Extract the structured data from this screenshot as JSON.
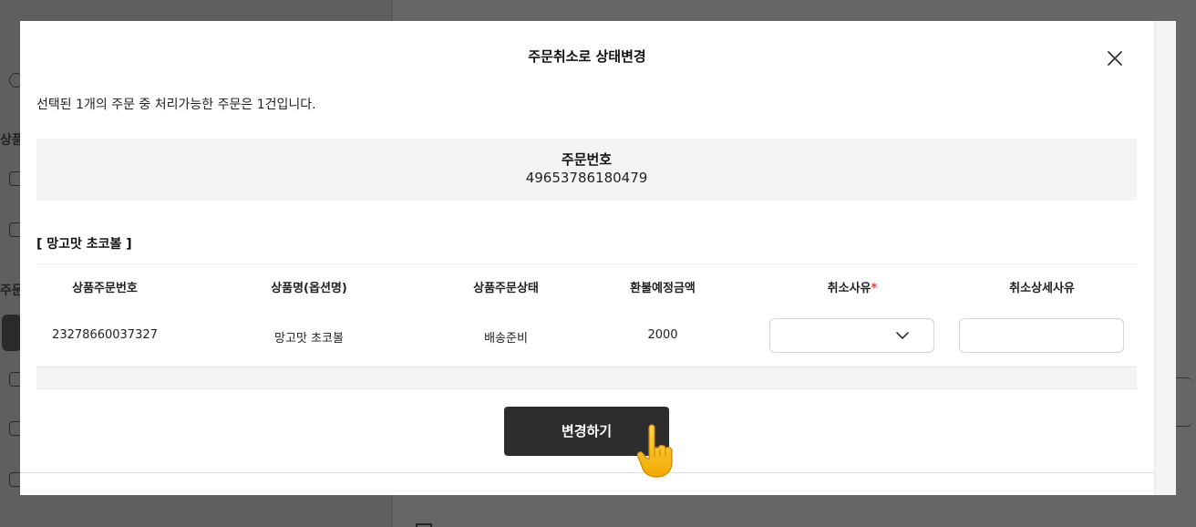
{
  "background": {
    "sidebar_labels": [
      "상품",
      "주문"
    ]
  },
  "modal": {
    "title": "주문취소로 상태변경",
    "notice": "선택된 1개의 주문 중 처리가능한 주문은 1건입니다.",
    "order_label": "주문번호",
    "order_number": "49653786180479",
    "product_title": "[ 망고맛 초코볼 ]",
    "columns": {
      "item_order_no": "상품주문번호",
      "product_name": "상품명(옵션명)",
      "item_status": "상품주문상태",
      "refund_amount": "환불예정금액",
      "cancel_reason": "취소사유",
      "cancel_reason_required": "*",
      "cancel_detail": "취소상세사유"
    },
    "rows": [
      {
        "item_order_no": "23278660037327",
        "product_name": "망고맛 초코볼",
        "item_status": "배송준비",
        "refund_amount": "2000",
        "cancel_reason_value": "",
        "cancel_detail_value": ""
      }
    ],
    "submit_label": "변경하기"
  },
  "colors": {
    "overlay": "#5d5d5d",
    "button": "#2d2d2d",
    "required": "#e53935",
    "panel_gray": "#f4f4f4"
  },
  "icons": [
    "close-icon",
    "chevron-down-icon",
    "pointing-hand-icon"
  ]
}
